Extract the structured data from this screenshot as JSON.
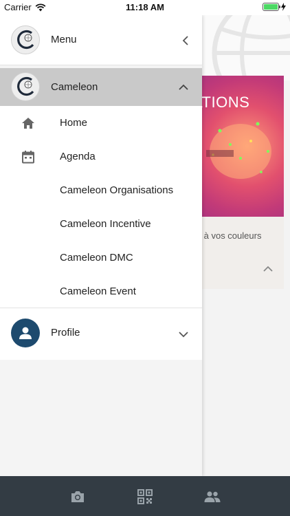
{
  "status_bar": {
    "carrier": "Carrier",
    "time": "11:18 AM"
  },
  "drawer": {
    "header": {
      "title": "Menu",
      "chevron": "chevron-left-icon"
    },
    "group": {
      "title": "Cameleon",
      "chevron": "chevron-up-icon",
      "items": [
        {
          "label": "Home",
          "icon": "home-icon"
        },
        {
          "label": "Agenda",
          "icon": "calendar-icon"
        },
        {
          "label": "Cameleon Organisations",
          "icon": ""
        },
        {
          "label": "Cameleon Incentive",
          "icon": ""
        },
        {
          "label": "Cameleon DMC",
          "icon": ""
        },
        {
          "label": "Cameleon Event",
          "icon": ""
        }
      ]
    },
    "profile": {
      "label": "Profile",
      "chevron": "chevron-down-icon"
    }
  },
  "background": {
    "card_title": "ATIONS",
    "card_text": "iel à vos couleurs"
  },
  "tab_bar": {
    "tabs": [
      {
        "icon": "camera-icon"
      },
      {
        "icon": "qr-code-icon"
      },
      {
        "icon": "people-icon"
      }
    ]
  },
  "colors": {
    "group_header_bg": "#c9c9c9",
    "tab_bar_bg": "#333c44",
    "profile_avatar_bg": "#1d4a6e",
    "battery_green": "#4cd964"
  }
}
